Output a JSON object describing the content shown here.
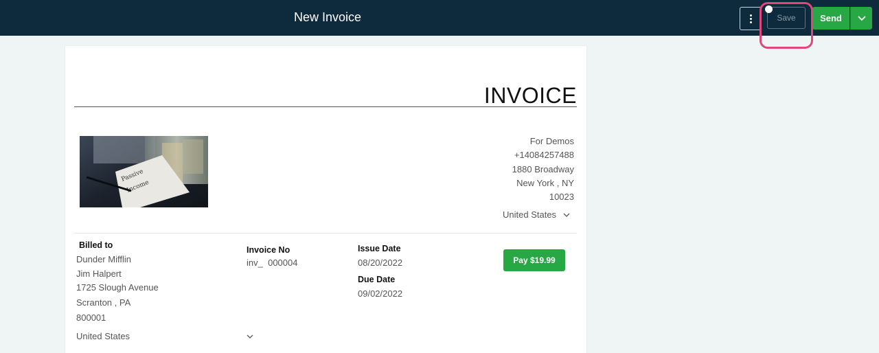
{
  "header": {
    "title": "New Invoice",
    "more_icon": "more-vertical-icon",
    "save_label": "Save",
    "send_label": "Send",
    "send_caret_icon": "chevron-down-icon"
  },
  "invoice": {
    "heading": "INVOICE",
    "logo_text": "Passive Income",
    "from": {
      "name": "For Demos",
      "phone": "+14084257488",
      "street": "1880 Broadway",
      "city": "New York",
      "state": "NY",
      "zip": "10023",
      "country": "United States"
    },
    "billed_to": {
      "label": "Billed to",
      "company": "Dunder Mifflin",
      "contact": "Jim Halpert",
      "street": "1725 Slough Avenue",
      "city": "Scranton",
      "state": "PA",
      "zip": "800001",
      "country": "United States"
    },
    "invoice_no": {
      "label": "Invoice No",
      "prefix": "inv_",
      "number": "000004"
    },
    "issue_date": {
      "label": "Issue Date",
      "value": "08/20/2022"
    },
    "due_date": {
      "label": "Due Date",
      "value": "09/02/2022"
    },
    "pay_button": "Pay $19.99"
  },
  "colors": {
    "topbar": "#0e2a3d",
    "accent_green": "#28a745",
    "highlight": "#e0467c",
    "background": "#eff4f5"
  }
}
